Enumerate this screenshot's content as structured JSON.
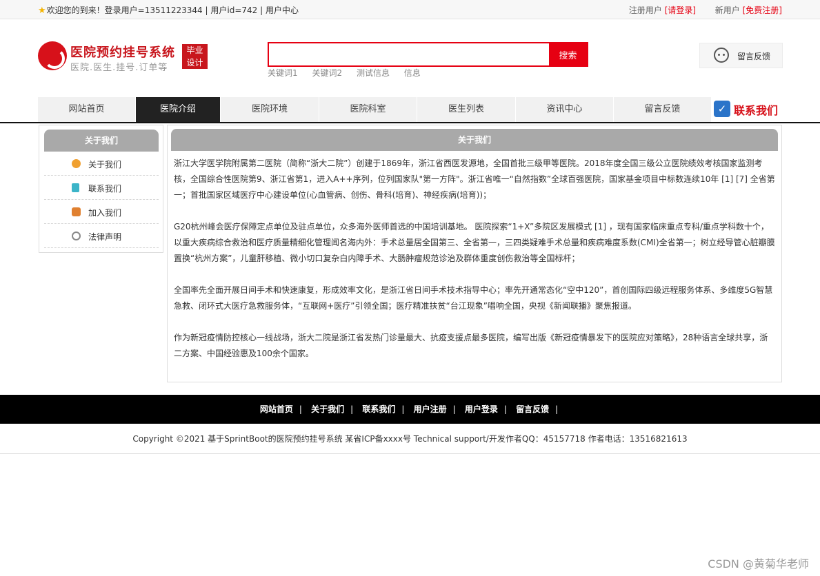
{
  "topbar": {
    "welcome": "欢迎您的到来！登录用户=13511223344 | 用户id=742 | 用户中心",
    "register_label": "注册用户",
    "register_link": "[请登录]",
    "new_user_label": "新用户",
    "new_user_link": "[免费注册]"
  },
  "header": {
    "logo_title": "医院预约挂号系统",
    "logo_subtitle": "医院.医生.挂号.订单等",
    "logo_badge_1": "毕业",
    "logo_badge_2": "设计",
    "search_value": "",
    "search_button": "搜索",
    "keywords": [
      "关键词1",
      "关键词2",
      "测试信息",
      "信息"
    ],
    "feedback_label": "留言反馈"
  },
  "nav": {
    "items": [
      "网站首页",
      "医院介绍",
      "医院环境",
      "医院科室",
      "医生列表",
      "资讯中心",
      "留言反馈"
    ],
    "active": "医院介绍",
    "contact_label": "联系我们"
  },
  "sidebar": {
    "title": "关于我们",
    "items": [
      {
        "label": "关于我们",
        "icon": "circle-icon",
        "color": "#f0a030"
      },
      {
        "label": "联系我们",
        "icon": "clipboard-icon",
        "color": "#3cb4c8"
      },
      {
        "label": "加入我们",
        "icon": "lock-icon",
        "color": "#e08030"
      },
      {
        "label": "法律声明",
        "icon": "power-icon",
        "color": "#888888"
      }
    ]
  },
  "main": {
    "title": "关于我们",
    "paragraphs": [
      "浙江大学医学院附属第二医院（简称“浙大二院”）创建于1869年，浙江省西医发源地，全国首批三级甲等医院。2018年度全国三级公立医院绩效考核国家监测考核，全国综合性医院第9、浙江省第1，进入A++序列，位列国家队\"第一方阵\"。浙江省唯一“自然指数”全球百强医院，国家基金项目中标数连续10年 [1] [7] 全省第一；首批国家区域医疗中心建设单位(心血管病、创伤、骨科(培育)、神经疾病(培育))；",
      "G20杭州峰会医疗保障定点单位及驻点单位，众多海外医师首选的中国培训基地。 医院探索“1+X”多院区发展模式 [1] ，现有国家临床重点专科/重点学科数十个，以重大疾病综合救治和医疗质量精细化管理闻名海内外：手术总量居全国第三、全省第一，三四类疑难手术总量和疾病难度系数(CMI)全省第一；树立经导管心脏瓣膜置换“杭州方案”，儿童肝移植、微小切口复杂白内障手术、大肠肿瘤规范诊治及群体重度创伤救治等全国标杆；",
      "全国率先全面开展日间手术和快速康复，形成效率文化，是浙江省日间手术技术指导中心；率先开通常态化“空中120”，首创国际四级远程服务体系、多维度5G智慧急救、闭环式大医疗急救服务体，“互联网+医疗”引领全国；医疗精准扶贫“台江现象”唱响全国，央视《新闻联播》聚焦报道。",
      " 作为新冠疫情防控核心一线战场，浙大二院是浙江省发热门诊量最大、抗疫支援点最多医院，编写出版《新冠疫情暴发下的医院应对策略》，28种语言全球共享，浙二方案、中国经验惠及100余个国家。"
    ]
  },
  "footer": {
    "links": [
      "网站首页",
      "关于我们",
      "联系我们",
      "用户注册",
      "用户登录",
      "留言反馈"
    ],
    "separator": "|",
    "copyright": "Copyright ©2021 基于SprintBoot的医院预约挂号系统    某省ICP备xxxx号    Technical support/开发作者QQ：45157718    作者电话：13516821613"
  },
  "watermark": "CSDN @黄菊华老师"
}
